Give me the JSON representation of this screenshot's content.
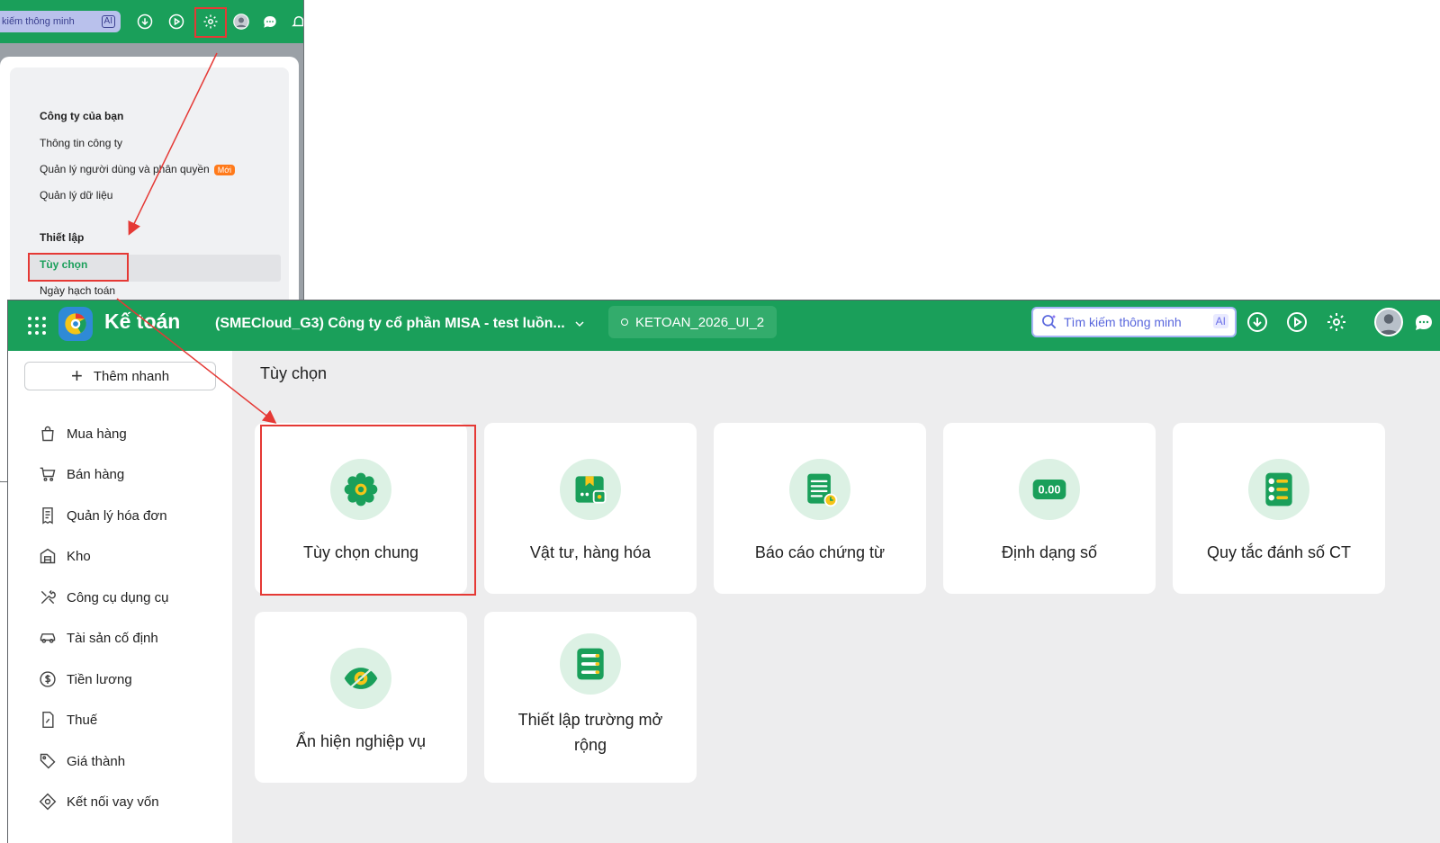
{
  "inset": {
    "search_placeholder": "kiếm thông minh",
    "search_ai": "AI",
    "sections": [
      {
        "title": "Công ty của bạn",
        "items": [
          "Thông tin công ty",
          "Quản lý người dùng và phân quyền",
          "Quản lý dữ liệu"
        ]
      },
      {
        "title": "Thiết lập",
        "items": [
          "Tùy chọn",
          "Ngày hạch toán"
        ]
      }
    ],
    "new_badge": "Mới",
    "active_item": "Tùy chọn"
  },
  "header": {
    "app_name": "Kế toán",
    "company": "(SMECloud_G3) Công ty cổ phần MISA - test luồn...",
    "database": "KETOAN_2026_UI_2",
    "search_placeholder": "Tìm kiếm thông minh",
    "search_ai": "AI"
  },
  "sidebar": {
    "quick_add": "Thêm nhanh",
    "items": [
      {
        "label": "Mua hàng",
        "icon": "shopping-bag-icon"
      },
      {
        "label": "Bán hàng",
        "icon": "cart-icon"
      },
      {
        "label": "Quản lý hóa đơn",
        "icon": "receipt-icon"
      },
      {
        "label": "Kho",
        "icon": "warehouse-icon"
      },
      {
        "label": "Công cụ dụng cụ",
        "icon": "tools-icon"
      },
      {
        "label": "Tài sản cố định",
        "icon": "car-icon"
      },
      {
        "label": "Tiền lương",
        "icon": "dollar-coin-icon"
      },
      {
        "label": "Thuế",
        "icon": "tax-document-icon"
      },
      {
        "label": "Giá thành",
        "icon": "price-tag-icon"
      },
      {
        "label": "Kết nối vay vốn",
        "icon": "loan-connect-icon"
      }
    ]
  },
  "main": {
    "title": "Tùy chọn",
    "cards": [
      {
        "label": "Tùy chọn chung",
        "icon": "gear-icon"
      },
      {
        "label": "Vật tư, hàng hóa",
        "icon": "goods-box-icon"
      },
      {
        "label": "Báo cáo chứng từ",
        "icon": "report-document-icon"
      },
      {
        "label": "Định dạng số",
        "icon": "number-format-icon"
      },
      {
        "label": "Quy tắc đánh số CT",
        "icon": "numbered-list-icon"
      },
      {
        "label": "Ẩn hiện nghiệp vụ",
        "icon": "eye-icon"
      },
      {
        "label": "Thiết lập trường mở rộng",
        "icon": "extended-fields-icon"
      }
    ]
  },
  "colors": {
    "brand_green": "#1a9f5a",
    "highlight_red": "#e53935",
    "icon_green": "#1a9f5a",
    "icon_yellow": "#f5c518",
    "new_badge": "#ff7a1a"
  }
}
